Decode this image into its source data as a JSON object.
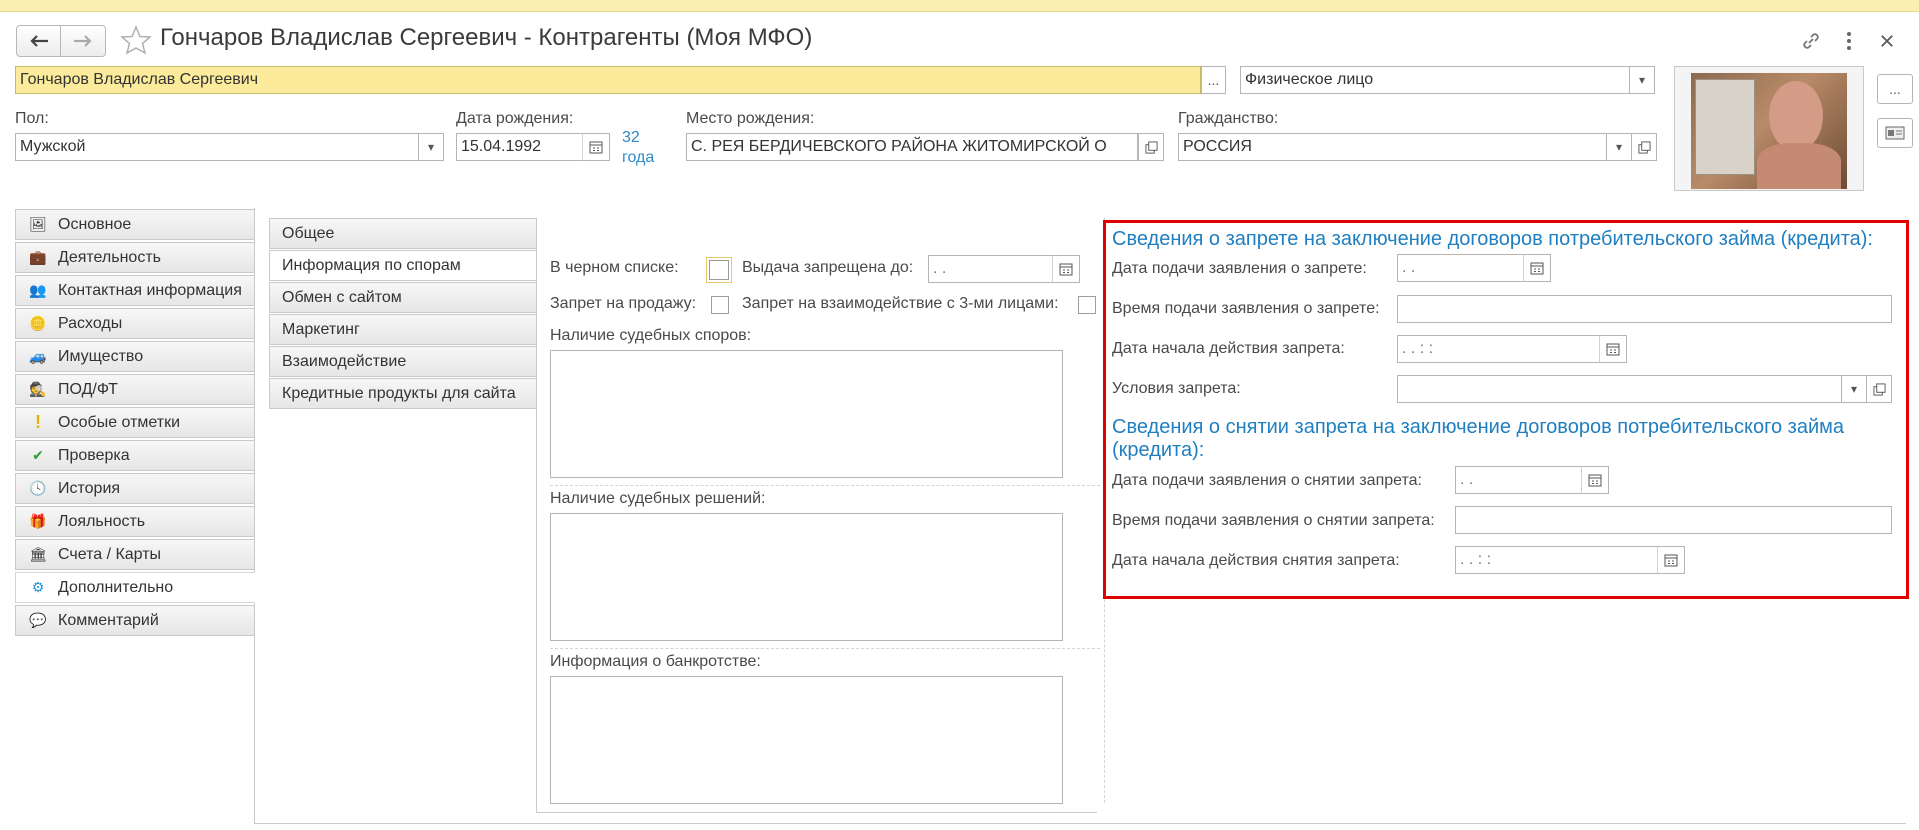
{
  "window": {
    "title": "Гончаров Владислав Сергеевич - Контрагенты (Моя МФО)"
  },
  "header": {
    "name_value": "Гончаров Владислав Сергеевич",
    "name_more": "...",
    "person_type": "Физическое лицо",
    "photo_more": "...",
    "gender_label": "Пол:",
    "gender_value": "Мужской",
    "birth_label": "Дата рождения:",
    "birth_value": "15.04.1992",
    "age_number": "32",
    "age_word": "года",
    "birthplace_label": "Место рождения:",
    "birthplace_value": "С. РЕЯ БЕРДИЧЕВСКОГО РАЙОНА ЖИТОМИРСКОЙ О",
    "citizenship_label": "Гражданство:",
    "citizenship_value": "РОССИЯ"
  },
  "left_panel": {
    "items": [
      {
        "label": "Основное",
        "icon": "photo-card-icon"
      },
      {
        "label": "Деятельность",
        "icon": "briefcase-icon"
      },
      {
        "label": "Контактная информация",
        "icon": "contacts-icon"
      },
      {
        "label": "Расходы",
        "icon": "coins-icon"
      },
      {
        "label": "Имущество",
        "icon": "car-icon"
      },
      {
        "label": "ПОД/ФТ",
        "icon": "agent-icon"
      },
      {
        "label": "Особые отметки",
        "icon": "exclamation-icon"
      },
      {
        "label": "Проверка",
        "icon": "checkmark-icon"
      },
      {
        "label": "История",
        "icon": "history-clock-icon"
      },
      {
        "label": "Лояльность",
        "icon": "gift-icon"
      },
      {
        "label": "Счета / Карты",
        "icon": "bank-icon"
      },
      {
        "label": "Дополнительно",
        "icon": "gear-icon"
      },
      {
        "label": "Комментарий",
        "icon": "comment-icon"
      }
    ],
    "active_index": 11
  },
  "mid_tabs": {
    "items": [
      "Общее",
      "Информация по спорам",
      "Обмен с сайтом",
      "Маркетинг",
      "Взаимодействие",
      "Кредитные продукты для сайта"
    ],
    "active_index": 1
  },
  "disputes": {
    "blacklist_label": "В черном списке:",
    "issue_banned_label": "Выдача запрещена до:",
    "issue_banned_value": " .  .",
    "sale_ban_label": "Запрет на продажу:",
    "third_party_ban_label": "Запрет на взаимодействие с 3-ми лицами:",
    "court_disputes_label": "Наличие судебных споров:",
    "court_decisions_label": "Наличие судебных решений:",
    "bankruptcy_label": "Информация о банкротстве:"
  },
  "ban": {
    "title": "Сведения о запрете на заключение договоров потребительского займа (кредита):",
    "apply_date_label": "Дата подачи заявления о запрете:",
    "apply_date_value": " .  .",
    "apply_time_label": "Время подачи заявления о запрете:",
    "apply_time_value": "",
    "start_date_label": "Дата начала действия запрета:",
    "start_date_value": " .  .      :  :",
    "conditions_label": "Условия запрета:",
    "conditions_value": ""
  },
  "unban": {
    "title_line1": "Сведения о снятии запрета на заключение договоров потребительского займа",
    "title_line2": "(кредита):",
    "apply_date_label": "Дата подачи заявления о снятии запрета:",
    "apply_date_value": " .  .",
    "apply_time_label": "Время подачи заявления о снятии запрета:",
    "apply_time_value": "",
    "start_date_label": "Дата начала действия снятия запрета:",
    "start_date_value": " .  .      :  :"
  },
  "colors": {
    "highlight_border": "#e00000",
    "section_title": "#1f7fc0",
    "name_field_bg": "#fbeb9b"
  }
}
